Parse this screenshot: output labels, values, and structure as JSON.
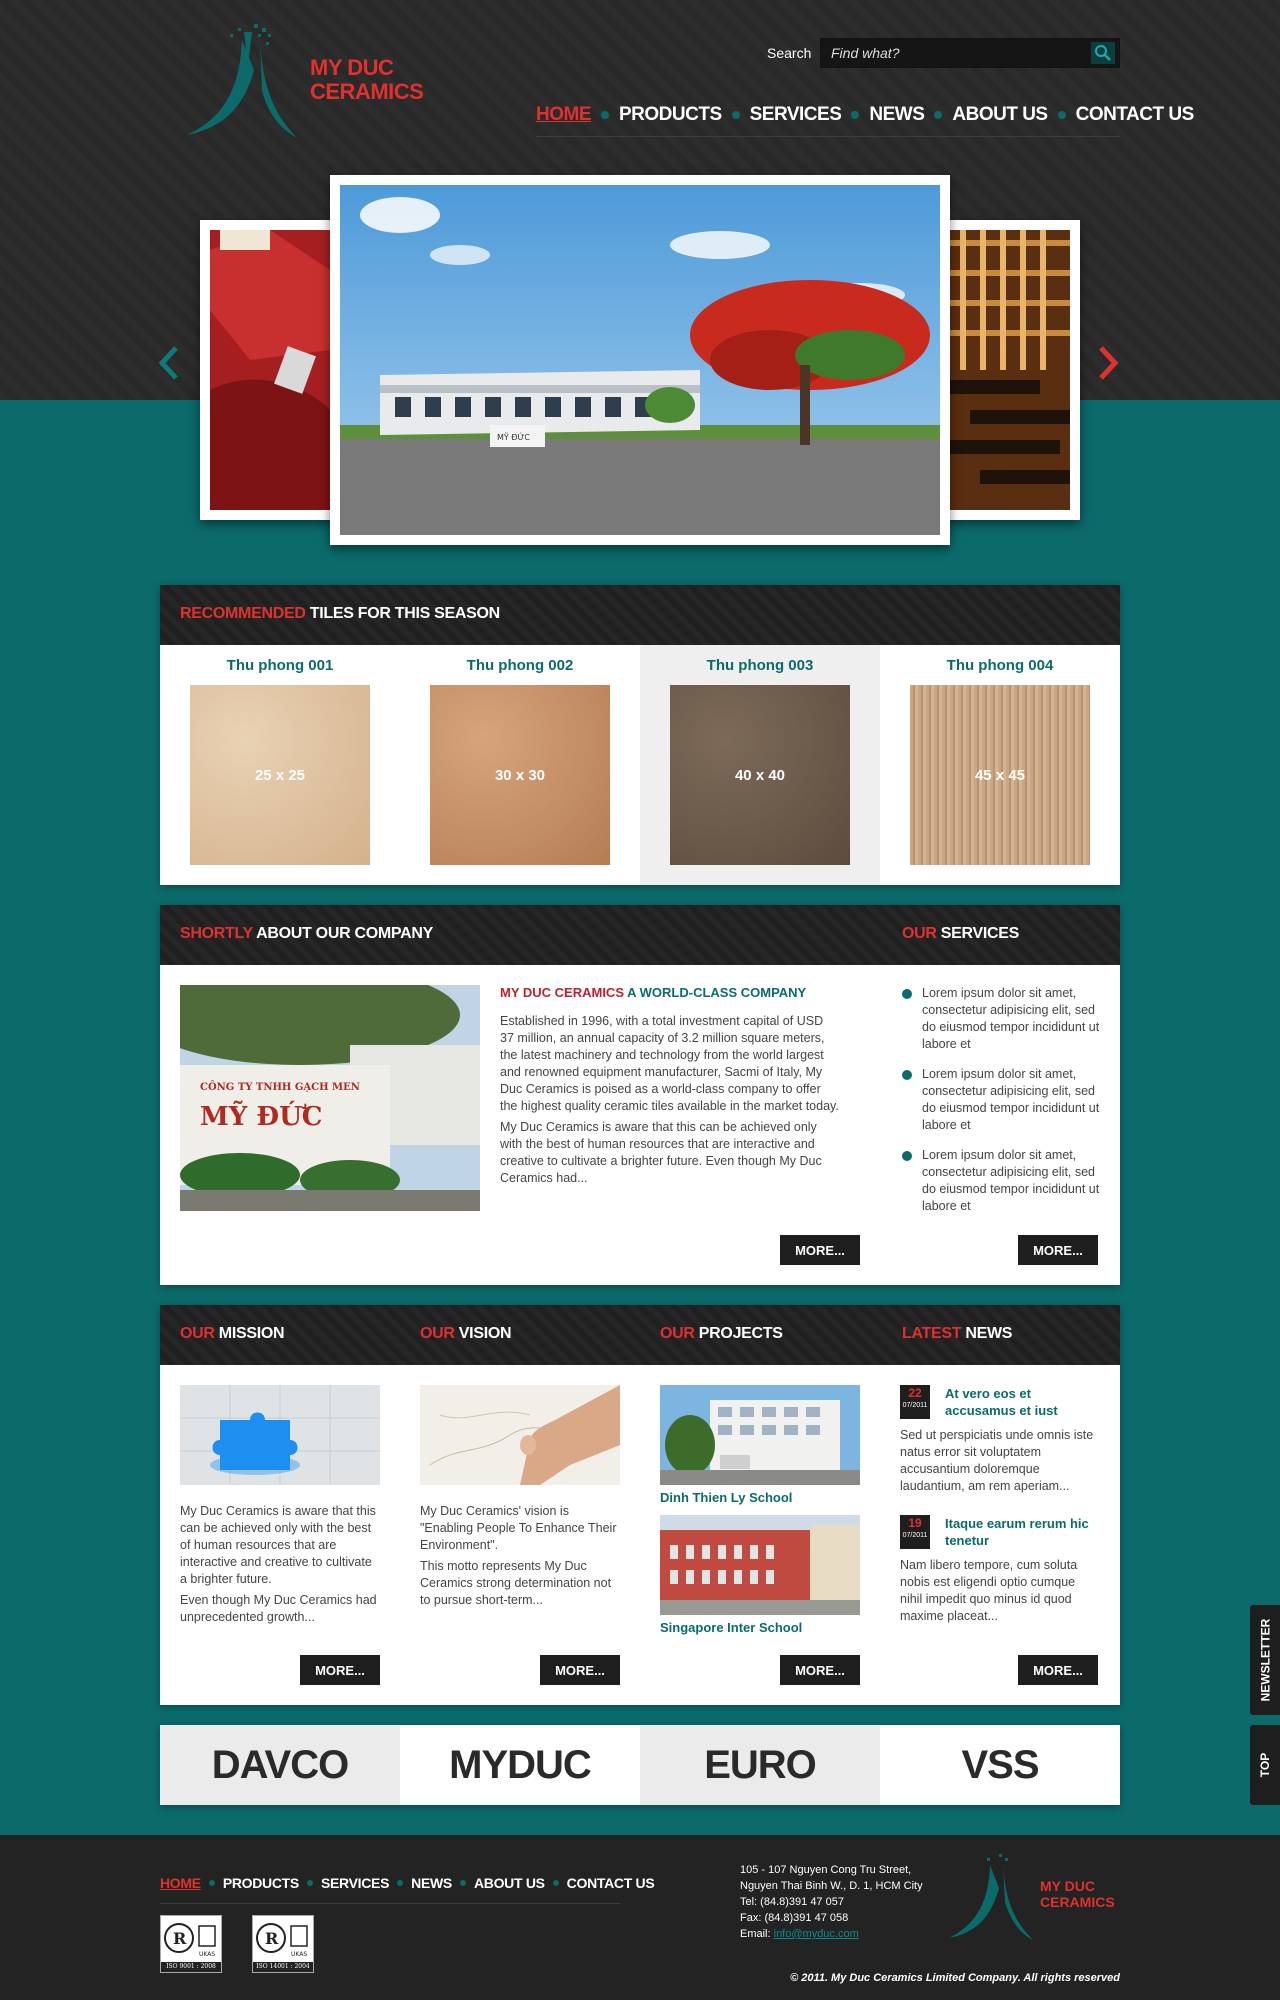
{
  "brand": {
    "name_line1": "MY DUC",
    "name_line2": "CERAMICS"
  },
  "search": {
    "label": "Search",
    "placeholder": "Find what?"
  },
  "nav": {
    "items": [
      {
        "label": "HOME"
      },
      {
        "label": "PRODUCTS"
      },
      {
        "label": "SERVICES"
      },
      {
        "label": "NEWS"
      },
      {
        "label": "ABOUT US"
      },
      {
        "label": "CONTACT US"
      }
    ]
  },
  "slider": {
    "caption_main": "MỸ ĐỨC"
  },
  "recommended": {
    "title_red": "RECOMMENDED",
    "title_white": " TILES FOR THIS SEASON",
    "tiles": [
      {
        "name": "Thu phong 001",
        "size": "25 x 25",
        "color": "#dcbf9c"
      },
      {
        "name": "Thu phong 002",
        "size": "30 x 30",
        "color": "#c4916a"
      },
      {
        "name": "Thu phong 003",
        "size": "40 x 40",
        "color": "#6e5c4c"
      },
      {
        "name": "Thu phong 004",
        "size": "45 x 45",
        "color": "#c8a584"
      }
    ]
  },
  "about": {
    "title_red": "SHORTLY",
    "title_white": " ABOUT OUR COMPANY",
    "sign_line1": "CÔNG TY TNHH GẠCH MEN",
    "sign_line2": "MỸ ĐỨC",
    "heading_red": "MY DUC CERAMICS",
    "heading_teal": " A WORLD-CLASS COMPANY",
    "para1": "Established in 1996, with a total investment capital of USD 37 million, an annual capacity of 3.2 million square meters, the latest machinery and technology from the world largest and renowned equipment manufacturer, Sacmi of Italy, My Duc Ceramics is poised as a world-class company to offer the highest quality ceramic tiles available in the market today.",
    "para2": "My Duc Ceramics is aware that this can be achieved only with the best of human resources that are interactive and creative to cultivate a brighter future. Even though My Duc Ceramics had...",
    "more": "MORE..."
  },
  "services": {
    "title_red": "OUR",
    "title_white": " SERVICES",
    "items": [
      "Lorem ipsum dolor sit amet, consectetur adipisicing elit, sed do eiusmod tempor incididunt ut labore et",
      "Lorem ipsum dolor sit amet, consectetur adipisicing elit, sed do eiusmod tempor incididunt ut labore et",
      "Lorem ipsum dolor sit amet, consectetur adipisicing elit, sed do eiusmod tempor incididunt ut labore et"
    ],
    "more": "MORE..."
  },
  "mission": {
    "title_red": "OUR",
    "title_white": " MISSION",
    "para1": "My Duc Ceramics is aware that this can be achieved only with the best of human resources that are interactive and creative to cultivate a brighter future.",
    "para2": "Even though My Duc Ceramics had unprecedented growth...",
    "more": "MORE..."
  },
  "vision": {
    "title_red": "OUR",
    "title_white": " VISION",
    "para1": "My Duc Ceramics' vision is \"Enabling People To Enhance Their Environment\".",
    "para2": "This motto represents My Duc Ceramics strong determination not to pursue short-term...",
    "more": "MORE..."
  },
  "projects": {
    "title_red": "OUR",
    "title_white": " PROJECTS",
    "items": [
      {
        "name": "Dinh Thien Ly School"
      },
      {
        "name": "Singapore Inter School"
      }
    ],
    "more": "MORE..."
  },
  "news": {
    "title_red": "LATEST",
    "title_white": " NEWS",
    "items": [
      {
        "day": "22",
        "month": "07/2011",
        "title": "At vero eos et accusamus et iust",
        "body": "Sed ut perspiciatis unde omnis iste natus error sit voluptatem accusantium doloremque laudantium, am rem aperiam..."
      },
      {
        "day": "19",
        "month": "07/2011",
        "title": "Itaque earum rerum hic tenetur",
        "body": "Nam libero tempore, cum soluta nobis est eligendi optio cumque nihil impedit quo minus id quod maxime placeat..."
      }
    ],
    "more": "MORE..."
  },
  "brands": [
    "DAVCO",
    "MYDUC",
    "EURO",
    "VSS"
  ],
  "side_tabs": {
    "newsletter": "NEWSLETTER",
    "top": "TOP"
  },
  "footer": {
    "nav": [
      "HOME",
      "PRODUCTS",
      "SERVICES",
      "NEWS",
      "ABOUT US",
      "CONTACT US"
    ],
    "certs": [
      "ISO 9001 : 2008",
      "ISO 14001 : 2004"
    ],
    "cert_mark": "R",
    "cert_org": "UKAS",
    "address_line1": "105 - 107 Nguyen Cong Tru Street,",
    "address_line2": "Nguyen Thai Binh W., D. 1, HCM City",
    "tel": "Tel: (84.8)391 47 057",
    "fax": "Fax: (84.8)391 47 058",
    "email_label": "Email: ",
    "email": "info@myduc.com",
    "copyright": "© 2011. My Duc Ceramics Limited Company. All rights reserved",
    "logo_line1": "MY DUC",
    "logo_line2": "CERAMICS"
  },
  "colors": {
    "teal": "#0b6b6b",
    "red": "#e0312f",
    "dark": "#222222"
  }
}
